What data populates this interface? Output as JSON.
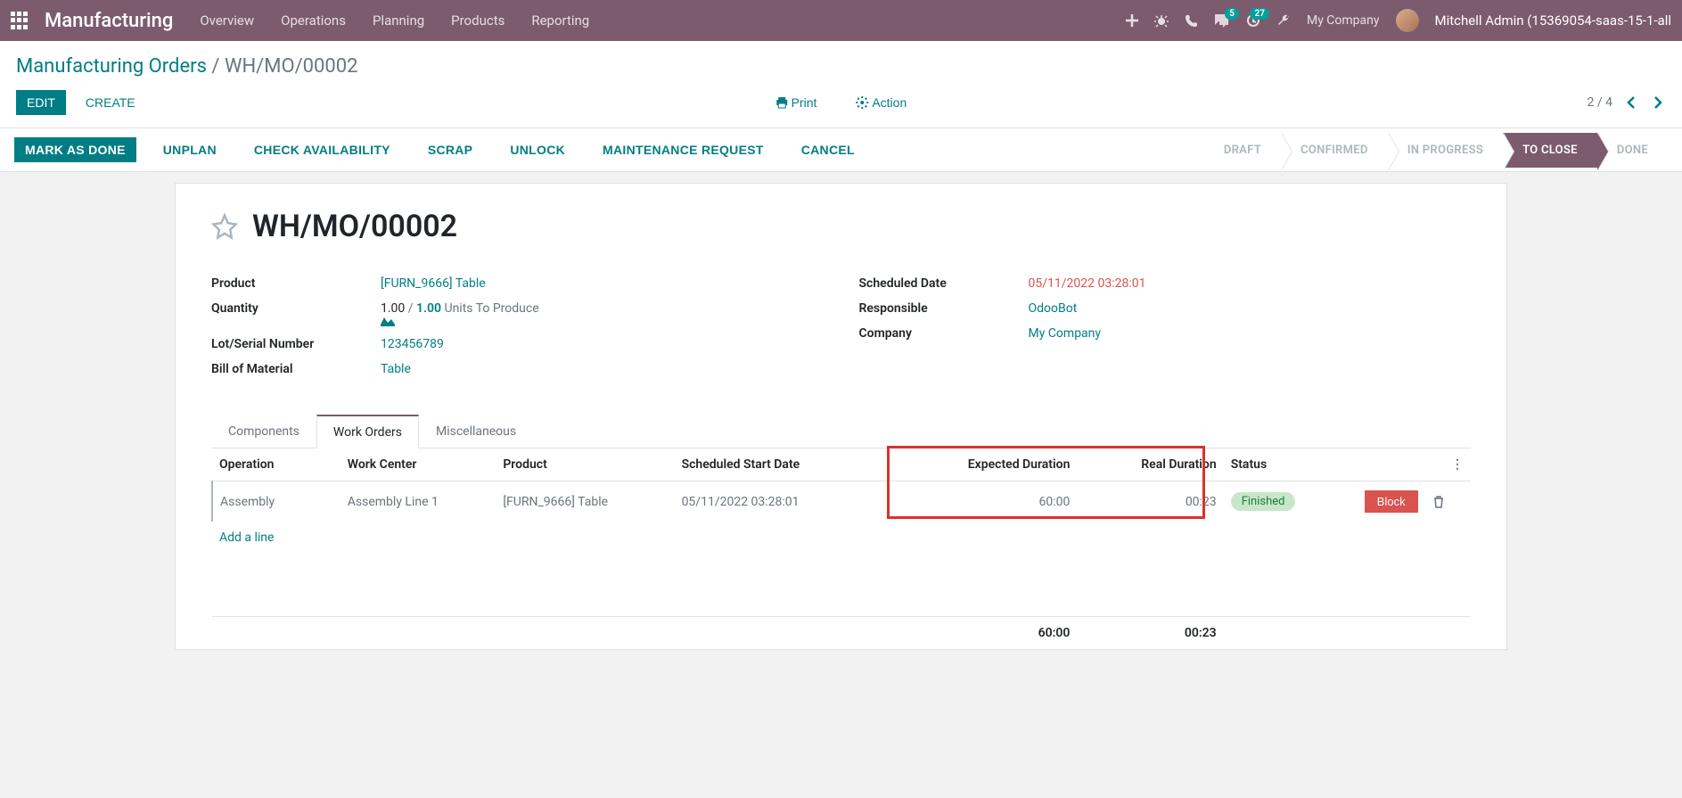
{
  "nav": {
    "brand": "Manufacturing",
    "menu": [
      "Overview",
      "Operations",
      "Planning",
      "Products",
      "Reporting"
    ],
    "msg_badge": "5",
    "act_badge": "27",
    "company": "My Company",
    "user": "Mitchell Admin (15369054-saas-15-1-all"
  },
  "breadcrumb": {
    "parent": "Manufacturing Orders",
    "sep": " / ",
    "current": "WH/MO/00002"
  },
  "buttons": {
    "edit": "EDIT",
    "create": "CREATE",
    "print": "Print",
    "action": "Action",
    "pager": "2 / 4"
  },
  "statusbar": {
    "mark_done": "MARK AS DONE",
    "unplan": "UNPLAN",
    "check_avail": "CHECK AVAILABILITY",
    "scrap": "SCRAP",
    "unlock": "UNLOCK",
    "maint_req": "MAINTENANCE REQUEST",
    "cancel": "CANCEL",
    "steps": [
      "DRAFT",
      "CONFIRMED",
      "IN PROGRESS",
      "TO CLOSE",
      "DONE"
    ],
    "active_index": 3
  },
  "sheet": {
    "title": "WH/MO/00002",
    "left": {
      "product_label": "Product",
      "product_value": "[FURN_9666] Table",
      "qty_label": "Quantity",
      "qty_from": "1.00",
      "qty_sep": " / ",
      "qty_to": "1.00",
      "qty_unit": "  Units",
      "qty_suffix": "  To Produce",
      "lot_label": "Lot/Serial Number",
      "lot_value": "123456789",
      "bom_label": "Bill of Material",
      "bom_value": "Table"
    },
    "right": {
      "sched_label": "Scheduled Date",
      "sched_value": "05/11/2022 03:28:01",
      "resp_label": "Responsible",
      "resp_value": "OdooBot",
      "company_label": "Company",
      "company_value": "My Company"
    }
  },
  "tabs": {
    "components": "Components",
    "work_orders": "Work Orders",
    "misc": "Miscellaneous"
  },
  "wo": {
    "headers": {
      "op": "Operation",
      "wc": "Work Center",
      "prod": "Product",
      "ssd": "Scheduled Start Date",
      "exp": "Expected Duration",
      "real": "Real Duration",
      "status": "Status"
    },
    "row": {
      "op": "Assembly",
      "wc": "Assembly Line 1",
      "prod": "[FURN_9666] Table",
      "ssd": "05/11/2022 03:28:01",
      "exp": "60:00",
      "real": "00:23",
      "status": "Finished",
      "block": "Block"
    },
    "add_line": "Add a line",
    "total_exp": "60:00",
    "total_real": "00:23"
  }
}
